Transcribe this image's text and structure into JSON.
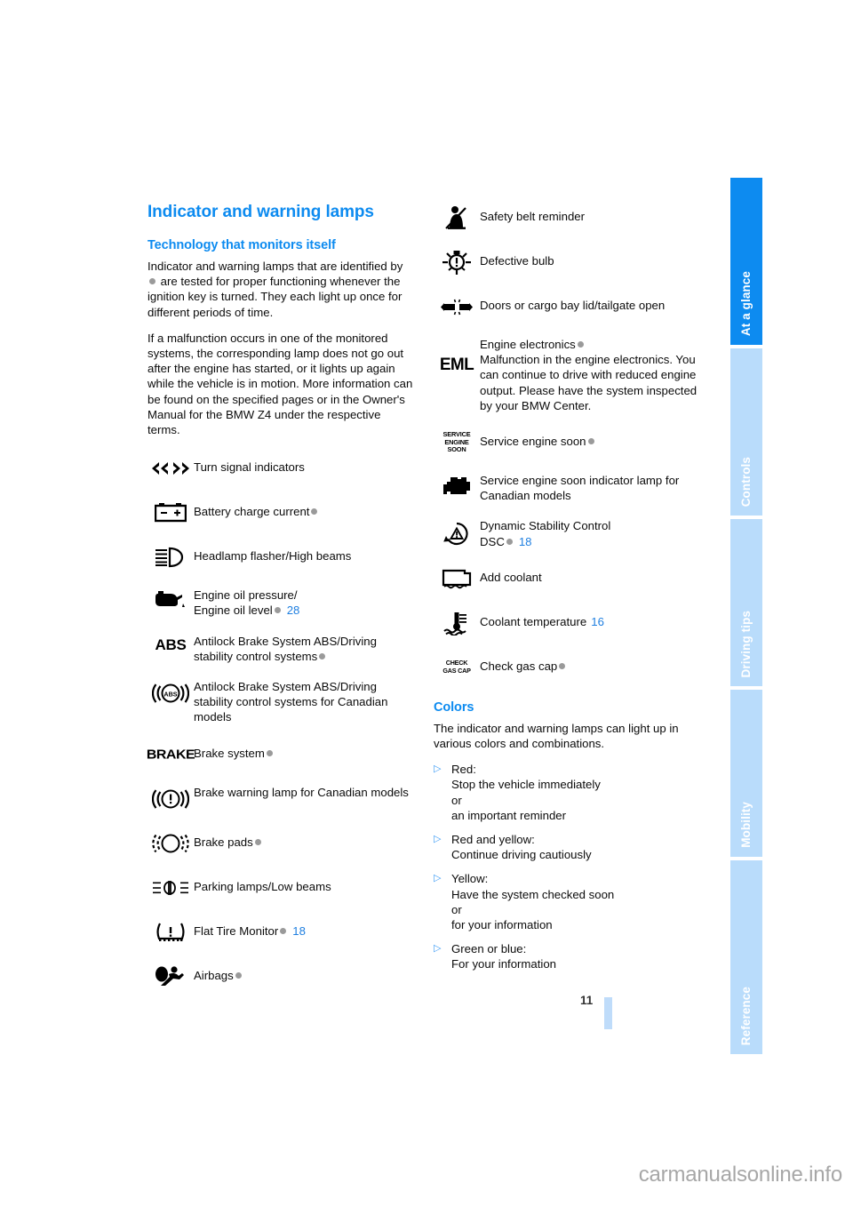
{
  "page": {
    "number": "11",
    "watermark": "carmanualsonline.info",
    "accent_blue": "#0d8bf0",
    "tab_active_blue": "#0d8bf0",
    "tab_inactive_blue": "#b9dcfb",
    "link_blue": "#1f7fe0"
  },
  "sidebar": {
    "tabs": [
      {
        "label": "At a glance",
        "active": true
      },
      {
        "label": "Controls",
        "active": false
      },
      {
        "label": "Driving tips",
        "active": false
      },
      {
        "label": "Mobility",
        "active": false
      },
      {
        "label": "Reference",
        "active": false
      }
    ]
  },
  "left": {
    "title": "Indicator and warning lamps",
    "subtitle": "Technology that monitors itself",
    "paragraph1_a": "Indicator and warning lamps that are identified by ",
    "paragraph1_b": " are tested for proper functioning whenever the ignition key is turned. They each light up once for different periods of time.",
    "paragraph2": "If a malfunction occurs in one of the monitored systems, the corresponding lamp does not go out after the engine has started, or it lights up again while the vehicle is in motion. More information can be found on the specified pages or in the Owner's Manual for the BMW Z4 under the respective terms.",
    "lamps": [
      {
        "icon": "turn-signal-arrows-icon",
        "label": "Turn signal indicators",
        "dot": false,
        "page": ""
      },
      {
        "icon": "battery-icon",
        "label": "Battery charge current",
        "dot": true,
        "page": ""
      },
      {
        "icon": "high-beam-icon",
        "label": "Headlamp flasher/High beams",
        "dot": false,
        "page": ""
      },
      {
        "icon": "engine-oil-can-icon",
        "label": "Engine oil pressure/\nEngine oil level",
        "dot": true,
        "page": "28"
      },
      {
        "icon": "abs-text-icon",
        "label": "Antilock Brake System ABS/Driving stability control systems",
        "dot": true,
        "page": ""
      },
      {
        "icon": "abs-circle-icon",
        "label": "Antilock Brake System ABS/Driving stability control systems for Canadian models",
        "dot": false,
        "page": ""
      },
      {
        "icon": "brake-text-icon",
        "label": "Brake system",
        "dot": true,
        "page": ""
      },
      {
        "icon": "brake-warning-circle-icon",
        "label": "Brake warning lamp for Canadian models",
        "dot": false,
        "page": ""
      },
      {
        "icon": "brake-pads-icon",
        "label": "Brake pads",
        "dot": true,
        "page": ""
      },
      {
        "icon": "parking-low-beam-icon",
        "label": "Parking lamps/Low beams",
        "dot": false,
        "page": ""
      },
      {
        "icon": "flat-tire-monitor-icon",
        "label": "Flat Tire Monitor",
        "dot": true,
        "page": "18"
      },
      {
        "icon": "airbag-icon",
        "label": "Airbags",
        "dot": true,
        "page": ""
      }
    ]
  },
  "right": {
    "lamps": [
      {
        "icon": "safety-belt-icon",
        "label": "Safety belt reminder",
        "dot": false,
        "page": ""
      },
      {
        "icon": "defective-bulb-icon",
        "label": "Defective bulb",
        "dot": false,
        "page": ""
      },
      {
        "icon": "doors-open-icon",
        "label": "Doors or cargo bay lid/tailgate open",
        "dot": false,
        "page": ""
      },
      {
        "icon": "eml-text-icon",
        "label": "Engine electronics",
        "dot": true,
        "page": "",
        "extra": "Malfunction in the engine electronics. You can continue to drive with reduced engine output. Please have the system inspected by your BMW Center."
      },
      {
        "icon": "service-engine-soon-text-icon",
        "label": "Service engine soon",
        "dot": true,
        "page": ""
      },
      {
        "icon": "check-engine-icon",
        "label": "Service engine soon indicator lamp for Canadian models",
        "dot": false,
        "page": ""
      },
      {
        "icon": "dsc-triangle-icon",
        "label": "Dynamic Stability Control\nDSC",
        "dot": true,
        "page": "18"
      },
      {
        "icon": "add-coolant-icon",
        "label": "Add coolant",
        "dot": false,
        "page": ""
      },
      {
        "icon": "coolant-temperature-icon",
        "label": "Coolant temperature",
        "dot": false,
        "page": "16"
      },
      {
        "icon": "check-gas-cap-text-icon",
        "label": "Check gas cap",
        "dot": true,
        "page": ""
      }
    ],
    "icon_text": {
      "abs": "ABS",
      "abs_small": "ABS",
      "brake": "BRAKE",
      "eml": "EML",
      "service_engine_soon": "SERVICE\nENGINE\nSOON",
      "check_gas_cap": "CHECK\nGAS CAP"
    },
    "colors_heading": "Colors",
    "colors_intro": "The indicator and warning lamps can light up in various colors and combinations.",
    "colors_items": [
      {
        "marker": "triangle-bullet-icon",
        "text": "Red:\nStop the vehicle immediately\nor\nan important reminder"
      },
      {
        "marker": "triangle-bullet-icon",
        "text": "Red and yellow:\nContinue driving cautiously"
      },
      {
        "marker": "triangle-bullet-icon",
        "text": "Yellow:\nHave the system checked soon\nor\nfor your information"
      },
      {
        "marker": "triangle-bullet-icon",
        "text": "Green or blue:\nFor your information"
      }
    ]
  }
}
